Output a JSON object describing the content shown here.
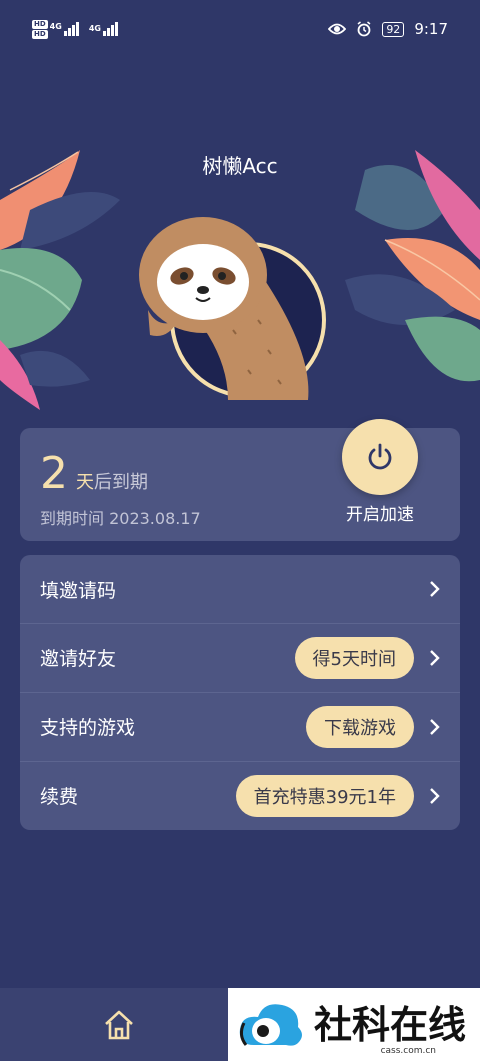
{
  "status": {
    "hd1": "HD",
    "hd2": "HD",
    "net1": "4G",
    "net2": "4G",
    "battery": "92",
    "time": "9:17"
  },
  "app": {
    "title": "树懒Acc"
  },
  "expiry": {
    "days": "2",
    "days_unit": "天",
    "days_suffix": "后到期",
    "expire_time": "到期时间 2023.08.17",
    "power_label": "开启加速"
  },
  "menu": [
    {
      "label": "填邀请码",
      "pill": ""
    },
    {
      "label": "邀请好友",
      "pill": "得5天时间"
    },
    {
      "label": "支持的游戏",
      "pill": "下载游戏"
    },
    {
      "label": "续费",
      "pill": "首充特惠39元1年"
    }
  ],
  "icons": {
    "power": "power-icon",
    "chevron": "chevron-right-icon",
    "home": "home-icon",
    "eye": "eye-icon",
    "alarm": "alarm-icon"
  },
  "watermark": {
    "text": "社科在线",
    "url": "cass.com.cn"
  },
  "colors": {
    "background": "#2f3768",
    "card": "#4d5582",
    "accent": "#f6e0ad"
  }
}
